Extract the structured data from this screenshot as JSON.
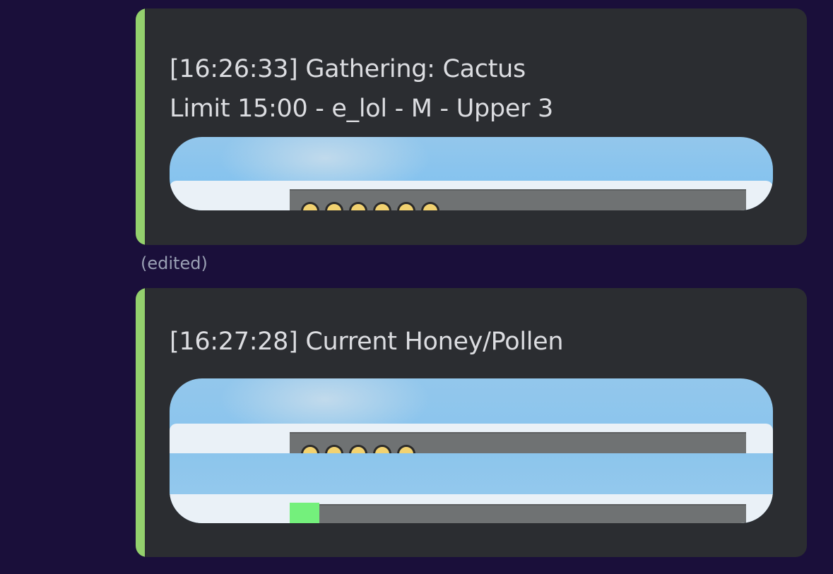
{
  "messages": [
    {
      "line1": "[16:26:33] Gathering: Cactus",
      "line2": "Limit 15:00 - e_lol - M - Upper 3",
      "accent_color": "#94d06d",
      "image_alt": "embed-screenshot-image"
    },
    {
      "line1": "[16:27:28] Current Honey/Pollen",
      "accent_color": "#94d06d",
      "image_alt": "embed-screenshot-image"
    }
  ],
  "edited_label": "(edited)",
  "colors": {
    "background": "#1a0f3a",
    "embed_background": "#2b2d31",
    "accent": "#94d06d",
    "text": "#dcdde1",
    "muted": "#9aa0b4"
  }
}
